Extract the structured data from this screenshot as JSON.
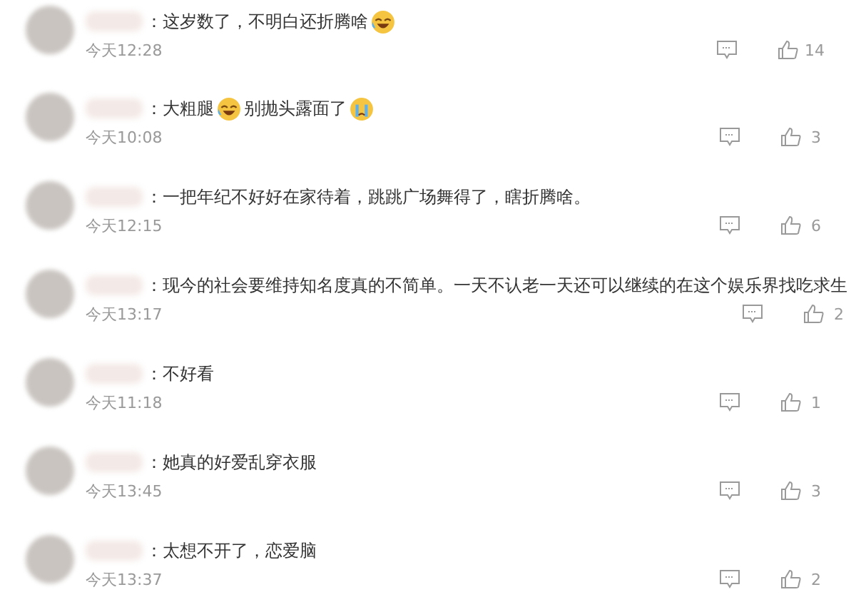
{
  "comments": [
    {
      "parts": [
        {
          "kind": "text",
          "text": "：这岁数了，不明白还折腾啥"
        },
        {
          "kind": "laugh_cry"
        }
      ],
      "time": "今天12:28",
      "likes": "14"
    },
    {
      "parts": [
        {
          "kind": "text",
          "text": "：大粗腿"
        },
        {
          "kind": "laugh_cry"
        },
        {
          "kind": "text",
          "text": "别抛头露面了"
        },
        {
          "kind": "cry"
        }
      ],
      "time": "今天10:08",
      "likes": "3"
    },
    {
      "parts": [
        {
          "kind": "text",
          "text": "：一把年纪不好好在家待着，跳跳广场舞得了，瞎折腾啥。"
        }
      ],
      "time": "今天12:15",
      "likes": "6"
    },
    {
      "parts": [
        {
          "kind": "text",
          "text": "：现今的社会要维持知名度真的不简单。一天不认老一天还可以继续的在这个娱乐界找吃求生"
        }
      ],
      "time": "今天13:17",
      "likes": "2"
    },
    {
      "parts": [
        {
          "kind": "text",
          "text": "：不好看"
        }
      ],
      "time": "今天11:18",
      "likes": "1"
    },
    {
      "parts": [
        {
          "kind": "text",
          "text": "：她真的好爱乱穿衣服"
        }
      ],
      "time": "今天13:45",
      "likes": "3"
    },
    {
      "parts": [
        {
          "kind": "text",
          "text": "：太想不开了，恋爱脑"
        }
      ],
      "time": "今天13:37",
      "likes": "2"
    }
  ]
}
